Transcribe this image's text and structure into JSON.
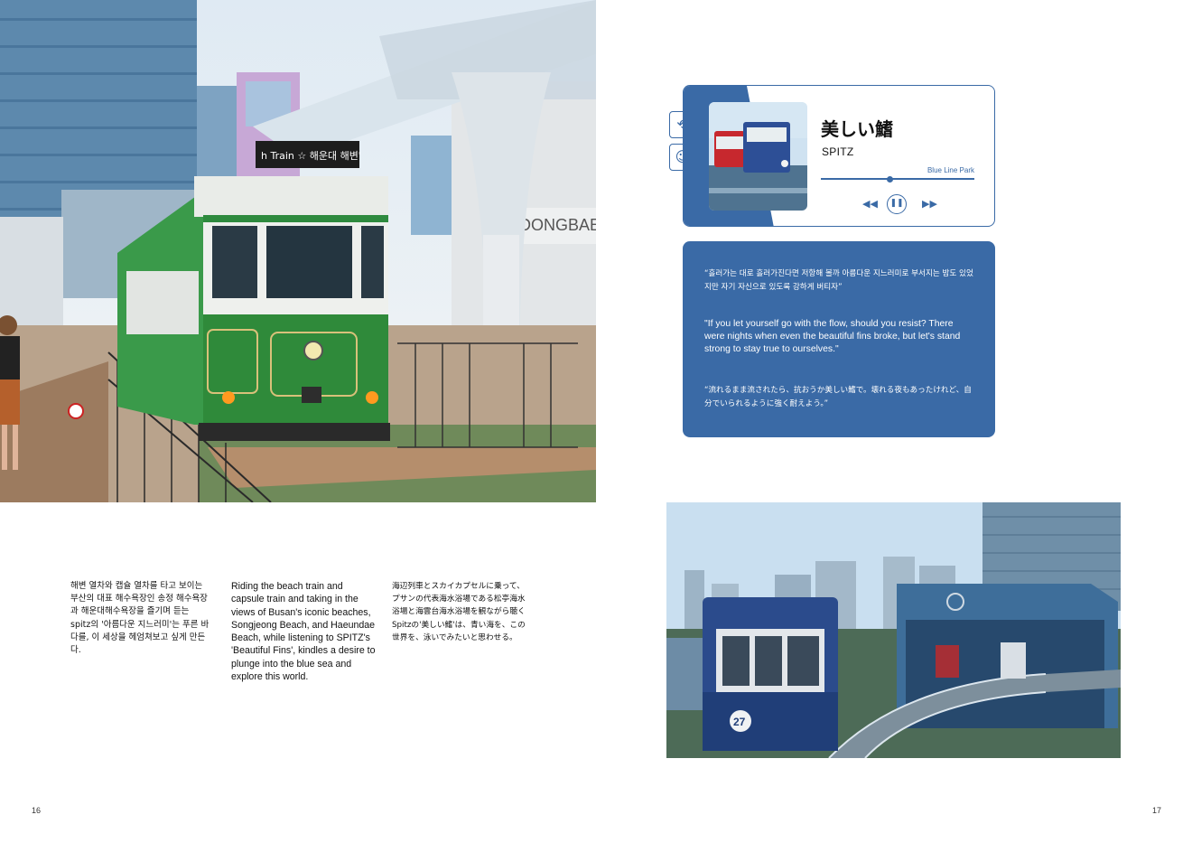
{
  "player": {
    "song_title": "美しい鰭",
    "artist": "SPITZ",
    "location": "Blue Line Park",
    "controls": {
      "prev": "◀◀",
      "pause": "❚❚",
      "next": "▶▶"
    },
    "progress": 0.43
  },
  "side_icons": {
    "share": "share-icon",
    "emoji": "smile-icon"
  },
  "lyrics": {
    "korean": "“흘러가는 대로 흘러가진다면 저항해 볼까 아름다운 지느러미로 부서지는 밤도 있었지만 자기 자신으로 있도록 강하게 버티자”",
    "english": "\"If you let yourself go with the flow, should you resist? There were nights when even the beautiful fins broke, but let's stand strong to stay true to ourselves.\"",
    "japanese": "“流れるまま流されたら、抗おうか美しい鰭で。壊れる夜もあったけれど、自分でいられるように強く耐えよう。”"
  },
  "photo_left": {
    "train_sign": "h Train ☆ 해운대 해변'",
    "cafe_sign": "DONGBAEK"
  },
  "body_text": {
    "korean": "해변 열차와 캡슐 열차를 타고 보이는 부산의 대표 해수욕장인 송정 해수욕장과 해운대해수욕장을 즐기며 듣는 spitz의 '아름다운 지느러미'는 푸른 바다를, 이 세상을 헤엄쳐보고 싶게 만든다.",
    "english": "Riding the beach train and capsule train and taking in the views of Busan's iconic beaches, Songjeong Beach, and Haeundae Beach, while listening to SPITZ's 'Beautiful Fins', kindles a desire to plunge into the blue sea and explore this world.",
    "japanese": "海辺列車とスカイカプセルに乗って、プサンの代表海水浴場である松亭海水浴場と海雲台海水浴場を観ながら聴くSpitzの'美しい鰭'は、青い海を、この世界を、泳いでみたいと思わせる。"
  },
  "page_numbers": {
    "left": "16",
    "right": "17"
  },
  "colors": {
    "accent": "#3a6aa6",
    "train_green": "#2f8a3a",
    "sky": "#cfe3f0"
  }
}
